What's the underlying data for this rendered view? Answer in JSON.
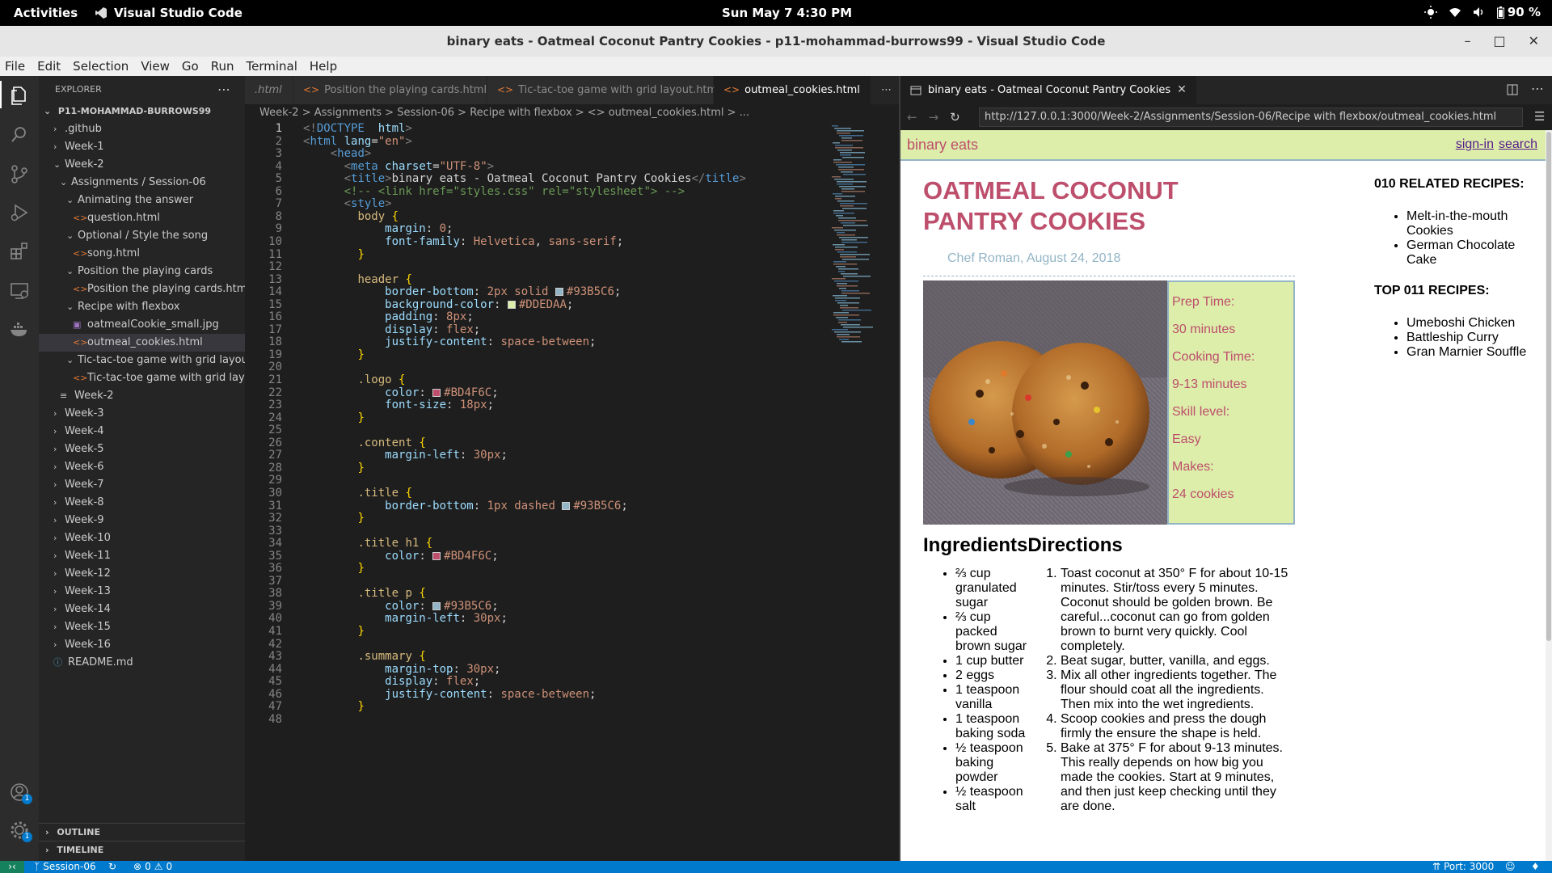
{
  "topbar": {
    "activities": "Activities",
    "app_name": "Visual Studio Code",
    "clock": "Sun May 7   4:30 PM",
    "battery": "90 %"
  },
  "window": {
    "title": "binary eats - Oatmeal Coconut Pantry Cookies - p11-mohammad-burrows99 - Visual Studio Code"
  },
  "menu": [
    "File",
    "Edit",
    "Selection",
    "View",
    "Go",
    "Run",
    "Terminal",
    "Help"
  ],
  "sidebar": {
    "header": "EXPLORER",
    "root": "P11-MOHAMMAD-BURROWS99",
    "tree": [
      {
        "label": ".github",
        "indent": 1,
        "type": "folder",
        "open": false
      },
      {
        "label": "Week-1",
        "indent": 1,
        "type": "folder",
        "open": false
      },
      {
        "label": "Week-2",
        "indent": 1,
        "type": "folder",
        "open": true
      },
      {
        "label": "Assignments / Session-06",
        "indent": 2,
        "type": "folder",
        "open": true
      },
      {
        "label": "Animating the answer",
        "indent": 3,
        "type": "folder",
        "open": true
      },
      {
        "label": "question.html",
        "indent": 4,
        "type": "html"
      },
      {
        "label": "Optional / Style the song",
        "indent": 3,
        "type": "folder",
        "open": true
      },
      {
        "label": "song.html",
        "indent": 4,
        "type": "html"
      },
      {
        "label": "Position the playing cards",
        "indent": 3,
        "type": "folder",
        "open": true
      },
      {
        "label": "Position the playing cards.html",
        "indent": 4,
        "type": "html"
      },
      {
        "label": "Recipe with flexbox",
        "indent": 3,
        "type": "folder",
        "open": true
      },
      {
        "label": "oatmealCookie_small.jpg",
        "indent": 4,
        "type": "img"
      },
      {
        "label": "outmeal_cookies.html",
        "indent": 4,
        "type": "html",
        "selected": true
      },
      {
        "label": "Tic-tac-toe game with grid layout",
        "indent": 3,
        "type": "folder",
        "open": true
      },
      {
        "label": "Tic-tac-toe game with grid layo...",
        "indent": 4,
        "type": "html"
      },
      {
        "label": "Week-2",
        "indent": 2,
        "type": "md"
      },
      {
        "label": "Week-3",
        "indent": 1,
        "type": "folder",
        "open": false
      },
      {
        "label": "Week-4",
        "indent": 1,
        "type": "folder",
        "open": false
      },
      {
        "label": "Week-5",
        "indent": 1,
        "type": "folder",
        "open": false
      },
      {
        "label": "Week-6",
        "indent": 1,
        "type": "folder",
        "open": false
      },
      {
        "label": "Week-7",
        "indent": 1,
        "type": "folder",
        "open": false
      },
      {
        "label": "Week-8",
        "indent": 1,
        "type": "folder",
        "open": false
      },
      {
        "label": "Week-9",
        "indent": 1,
        "type": "folder",
        "open": false
      },
      {
        "label": "Week-10",
        "indent": 1,
        "type": "folder",
        "open": false
      },
      {
        "label": "Week-11",
        "indent": 1,
        "type": "folder",
        "open": false
      },
      {
        "label": "Week-12",
        "indent": 1,
        "type": "folder",
        "open": false
      },
      {
        "label": "Week-13",
        "indent": 1,
        "type": "folder",
        "open": false
      },
      {
        "label": "Week-14",
        "indent": 1,
        "type": "folder",
        "open": false
      },
      {
        "label": "Week-15",
        "indent": 1,
        "type": "folder",
        "open": false
      },
      {
        "label": "Week-16",
        "indent": 1,
        "type": "folder",
        "open": false
      },
      {
        "label": "README.md",
        "indent": 1,
        "type": "info"
      }
    ],
    "outline": "OUTLINE",
    "timeline": "TIMELINE"
  },
  "editor": {
    "tabs": [
      {
        "label": ".html",
        "active": false
      },
      {
        "label": "Position the playing cards.html",
        "active": false
      },
      {
        "label": "Tic-tac-toe game with grid layout.html",
        "active": false
      },
      {
        "label": "outmeal_cookies.html",
        "active": true
      }
    ],
    "breadcrumb": "Week-2 > Assignments > Session-06 > Recipe with flexbox > <> outmeal_cookies.html > ...",
    "lines": [
      [
        [
          "t",
          "<!"
        ],
        [
          "k",
          "DOCTYPE"
        ],
        [
          "",
          "  "
        ],
        [
          "a",
          "html"
        ],
        [
          "t",
          ">"
        ]
      ],
      [
        [
          "t",
          "<"
        ],
        [
          "k",
          "html"
        ],
        [
          "",
          " "
        ],
        [
          "a",
          "lang"
        ],
        [
          "",
          "="
        ],
        [
          "s",
          "\"en\""
        ],
        [
          "t",
          ">"
        ]
      ],
      [
        [
          "",
          "    "
        ],
        [
          "t",
          "<"
        ],
        [
          "k",
          "head"
        ],
        [
          "t",
          ">"
        ]
      ],
      [
        [
          "",
          "      "
        ],
        [
          "t",
          "<"
        ],
        [
          "k",
          "meta"
        ],
        [
          "",
          " "
        ],
        [
          "a",
          "charset"
        ],
        [
          "",
          "="
        ],
        [
          "s",
          "\"UTF-8\""
        ],
        [
          "t",
          ">"
        ]
      ],
      [
        [
          "",
          "      "
        ],
        [
          "t",
          "<"
        ],
        [
          "k",
          "title"
        ],
        [
          "t",
          ">"
        ],
        [
          "",
          "binary eats - Oatmeal Coconut Pantry Cookies"
        ],
        [
          "t",
          "</"
        ],
        [
          "k",
          "title"
        ],
        [
          "t",
          ">"
        ]
      ],
      [
        [
          "",
          "      "
        ],
        [
          "c",
          "<!-- <link href=\"styles.css\" rel=\"stylesheet\"> -->"
        ]
      ],
      [
        [
          "",
          "      "
        ],
        [
          "t",
          "<"
        ],
        [
          "k",
          "style"
        ],
        [
          "t",
          ">"
        ]
      ],
      [
        [
          "",
          "        "
        ],
        [
          "sel-c",
          "body"
        ],
        [
          "",
          " "
        ],
        [
          "b",
          "{"
        ]
      ],
      [
        [
          "",
          "            "
        ],
        [
          "p",
          "margin"
        ],
        [
          "",
          ": "
        ],
        [
          "v",
          "0"
        ],
        [
          "",
          ";"
        ]
      ],
      [
        [
          "",
          "            "
        ],
        [
          "p",
          "font-family"
        ],
        [
          "",
          ": "
        ],
        [
          "v",
          "Helvetica"
        ],
        [
          "",
          ", "
        ],
        [
          "v",
          "sans-serif"
        ],
        [
          "",
          ";"
        ]
      ],
      [
        [
          "",
          "        "
        ],
        [
          "b",
          "}"
        ]
      ],
      [
        [
          "",
          ""
        ]
      ],
      [
        [
          "",
          "        "
        ],
        [
          "sel-c",
          "header"
        ],
        [
          "",
          " "
        ],
        [
          "b",
          "{"
        ]
      ],
      [
        [
          "",
          "            "
        ],
        [
          "p",
          "border-bottom"
        ],
        [
          "",
          ": "
        ],
        [
          "v",
          "2px solid"
        ],
        [
          "",
          " "
        ],
        [
          "sw",
          "#93B5C6"
        ],
        [
          "v",
          "#93B5C6"
        ],
        [
          "",
          ";"
        ]
      ],
      [
        [
          "",
          "            "
        ],
        [
          "p",
          "background-color"
        ],
        [
          "",
          ": "
        ],
        [
          "sw",
          "#DDEDAA"
        ],
        [
          "v",
          "#DDEDAA"
        ],
        [
          "",
          ";"
        ]
      ],
      [
        [
          "",
          "            "
        ],
        [
          "p",
          "padding"
        ],
        [
          "",
          ": "
        ],
        [
          "v",
          "8px"
        ],
        [
          "",
          ";"
        ]
      ],
      [
        [
          "",
          "            "
        ],
        [
          "p",
          "display"
        ],
        [
          "",
          ": "
        ],
        [
          "v",
          "flex"
        ],
        [
          "",
          ";"
        ]
      ],
      [
        [
          "",
          "            "
        ],
        [
          "p",
          "justify-content"
        ],
        [
          "",
          ": "
        ],
        [
          "v",
          "space-between"
        ],
        [
          "",
          ";"
        ]
      ],
      [
        [
          "",
          "        "
        ],
        [
          "b",
          "}"
        ]
      ],
      [
        [
          "",
          ""
        ]
      ],
      [
        [
          "",
          "        "
        ],
        [
          "sel-c",
          ".logo"
        ],
        [
          "",
          " "
        ],
        [
          "b",
          "{"
        ]
      ],
      [
        [
          "",
          "            "
        ],
        [
          "p",
          "color"
        ],
        [
          "",
          ": "
        ],
        [
          "sw",
          "#BD4F6C"
        ],
        [
          "v",
          "#BD4F6C"
        ],
        [
          "",
          ";"
        ]
      ],
      [
        [
          "",
          "            "
        ],
        [
          "p",
          "font-size"
        ],
        [
          "",
          ": "
        ],
        [
          "v",
          "18px"
        ],
        [
          "",
          ";"
        ]
      ],
      [
        [
          "",
          "        "
        ],
        [
          "b",
          "}"
        ]
      ],
      [
        [
          "",
          ""
        ]
      ],
      [
        [
          "",
          "        "
        ],
        [
          "sel-c",
          ".content"
        ],
        [
          "",
          " "
        ],
        [
          "b",
          "{"
        ]
      ],
      [
        [
          "",
          "            "
        ],
        [
          "p",
          "margin-left"
        ],
        [
          "",
          ": "
        ],
        [
          "v",
          "30px"
        ],
        [
          "",
          ";"
        ]
      ],
      [
        [
          "",
          "        "
        ],
        [
          "b",
          "}"
        ]
      ],
      [
        [
          "",
          ""
        ]
      ],
      [
        [
          "",
          "        "
        ],
        [
          "sel-c",
          ".title"
        ],
        [
          "",
          " "
        ],
        [
          "b",
          "{"
        ]
      ],
      [
        [
          "",
          "            "
        ],
        [
          "p",
          "border-bottom"
        ],
        [
          "",
          ": "
        ],
        [
          "v",
          "1px dashed"
        ],
        [
          "",
          " "
        ],
        [
          "sw",
          "#93B5C6"
        ],
        [
          "v",
          "#93B5C6"
        ],
        [
          "",
          ";"
        ]
      ],
      [
        [
          "",
          "        "
        ],
        [
          "b",
          "}"
        ]
      ],
      [
        [
          "",
          ""
        ]
      ],
      [
        [
          "",
          "        "
        ],
        [
          "sel-c",
          ".title h1"
        ],
        [
          "",
          " "
        ],
        [
          "b",
          "{"
        ]
      ],
      [
        [
          "",
          "            "
        ],
        [
          "p",
          "color"
        ],
        [
          "",
          ": "
        ],
        [
          "sw",
          "#BD4F6C"
        ],
        [
          "v",
          "#BD4F6C"
        ],
        [
          "",
          ";"
        ]
      ],
      [
        [
          "",
          "        "
        ],
        [
          "b",
          "}"
        ]
      ],
      [
        [
          "",
          ""
        ]
      ],
      [
        [
          "",
          "        "
        ],
        [
          "sel-c",
          ".title p"
        ],
        [
          "",
          " "
        ],
        [
          "b",
          "{"
        ]
      ],
      [
        [
          "",
          "            "
        ],
        [
          "p",
          "color"
        ],
        [
          "",
          ": "
        ],
        [
          "sw",
          "#93B5C6"
        ],
        [
          "v",
          "#93B5C6"
        ],
        [
          "",
          ";"
        ]
      ],
      [
        [
          "",
          "            "
        ],
        [
          "p",
          "margin-left"
        ],
        [
          "",
          ": "
        ],
        [
          "v",
          "30px"
        ],
        [
          "",
          ";"
        ]
      ],
      [
        [
          "",
          "        "
        ],
        [
          "b",
          "}"
        ]
      ],
      [
        [
          "",
          ""
        ]
      ],
      [
        [
          "",
          "        "
        ],
        [
          "sel-c",
          ".summary"
        ],
        [
          "",
          " "
        ],
        [
          "b",
          "{"
        ]
      ],
      [
        [
          "",
          "            "
        ],
        [
          "p",
          "margin-top"
        ],
        [
          "",
          ": "
        ],
        [
          "v",
          "30px"
        ],
        [
          "",
          ";"
        ]
      ],
      [
        [
          "",
          "            "
        ],
        [
          "p",
          "display"
        ],
        [
          "",
          ": "
        ],
        [
          "v",
          "flex"
        ],
        [
          "",
          ";"
        ]
      ],
      [
        [
          "",
          "            "
        ],
        [
          "p",
          "justify-content"
        ],
        [
          "",
          ": "
        ],
        [
          "v",
          "space-between"
        ],
        [
          "",
          ";"
        ]
      ],
      [
        [
          "",
          "        "
        ],
        [
          "b",
          "}"
        ]
      ],
      [
        [
          "",
          ""
        ]
      ]
    ]
  },
  "browser": {
    "tab_title": "binary eats - Oatmeal Coconut Pantry Cookies",
    "url": "http://127.0.0.1:3000/Week-2/Assignments/Session-06/Recipe with flexbox/outmeal_cookies.html",
    "page": {
      "logo": "binary eats",
      "signin": "sign-in",
      "search": "search",
      "title_line1": "OATMEAL COCONUT",
      "title_line2": "PANTRY COOKIES",
      "byline": "Chef Roman, August 24, 2018",
      "summary": [
        "Prep Time:",
        "30 minutes",
        "Cooking Time:",
        "9-13 minutes",
        "Skill level:",
        "Easy",
        "Makes:",
        "24 cookies"
      ],
      "ingredients_heading": "IngredientsDirections",
      "ingredients": [
        "⅔ cup granulated sugar",
        "⅔ cup packed brown sugar",
        "1 cup butter",
        "2 eggs",
        "1 teaspoon vanilla",
        "1 teaspoon baking soda",
        "½ teaspoon baking powder",
        "½ teaspoon salt"
      ],
      "directions": [
        "Toast coconut at 350° F for about 10-15 minutes. Stir/toss every 5 minutes. Coconut should be golden brown. Be careful...coconut can go from golden brown to burnt very quickly. Cool completely.",
        "Beat sugar, butter, vanilla, and eggs.",
        "Mix all other ingredients together. The flour should coat all the ingredients. Then mix into the wet ingredients.",
        "Scoop cookies and press the dough firmly the ensure the shape is held.",
        "Bake at 375° F for about 9-13 minutes. This really depends on how big you made the cookies. Start at 9 minutes, and then just keep checking until they are done."
      ],
      "related_heading": "010 RELATED RECIPES:",
      "related": [
        "Melt-in-the-mouth Cookies",
        "German Chocolate Cake"
      ],
      "top_heading": "TOP 011 RECIPES:",
      "top": [
        "Umeboshi Chicken",
        "Battleship Curry",
        "Gran Marnier Souffle"
      ]
    }
  },
  "status": {
    "branch": "Session-06",
    "problems": "0",
    "warnings": "0",
    "port": "Port: 3000"
  },
  "badges": {
    "accounts": "1",
    "settings": "1"
  },
  "colors": {
    "accent": "#007acc",
    "logo": "#BD4F6C",
    "border": "#93B5C6",
    "header_bg": "#DDEDAA"
  }
}
